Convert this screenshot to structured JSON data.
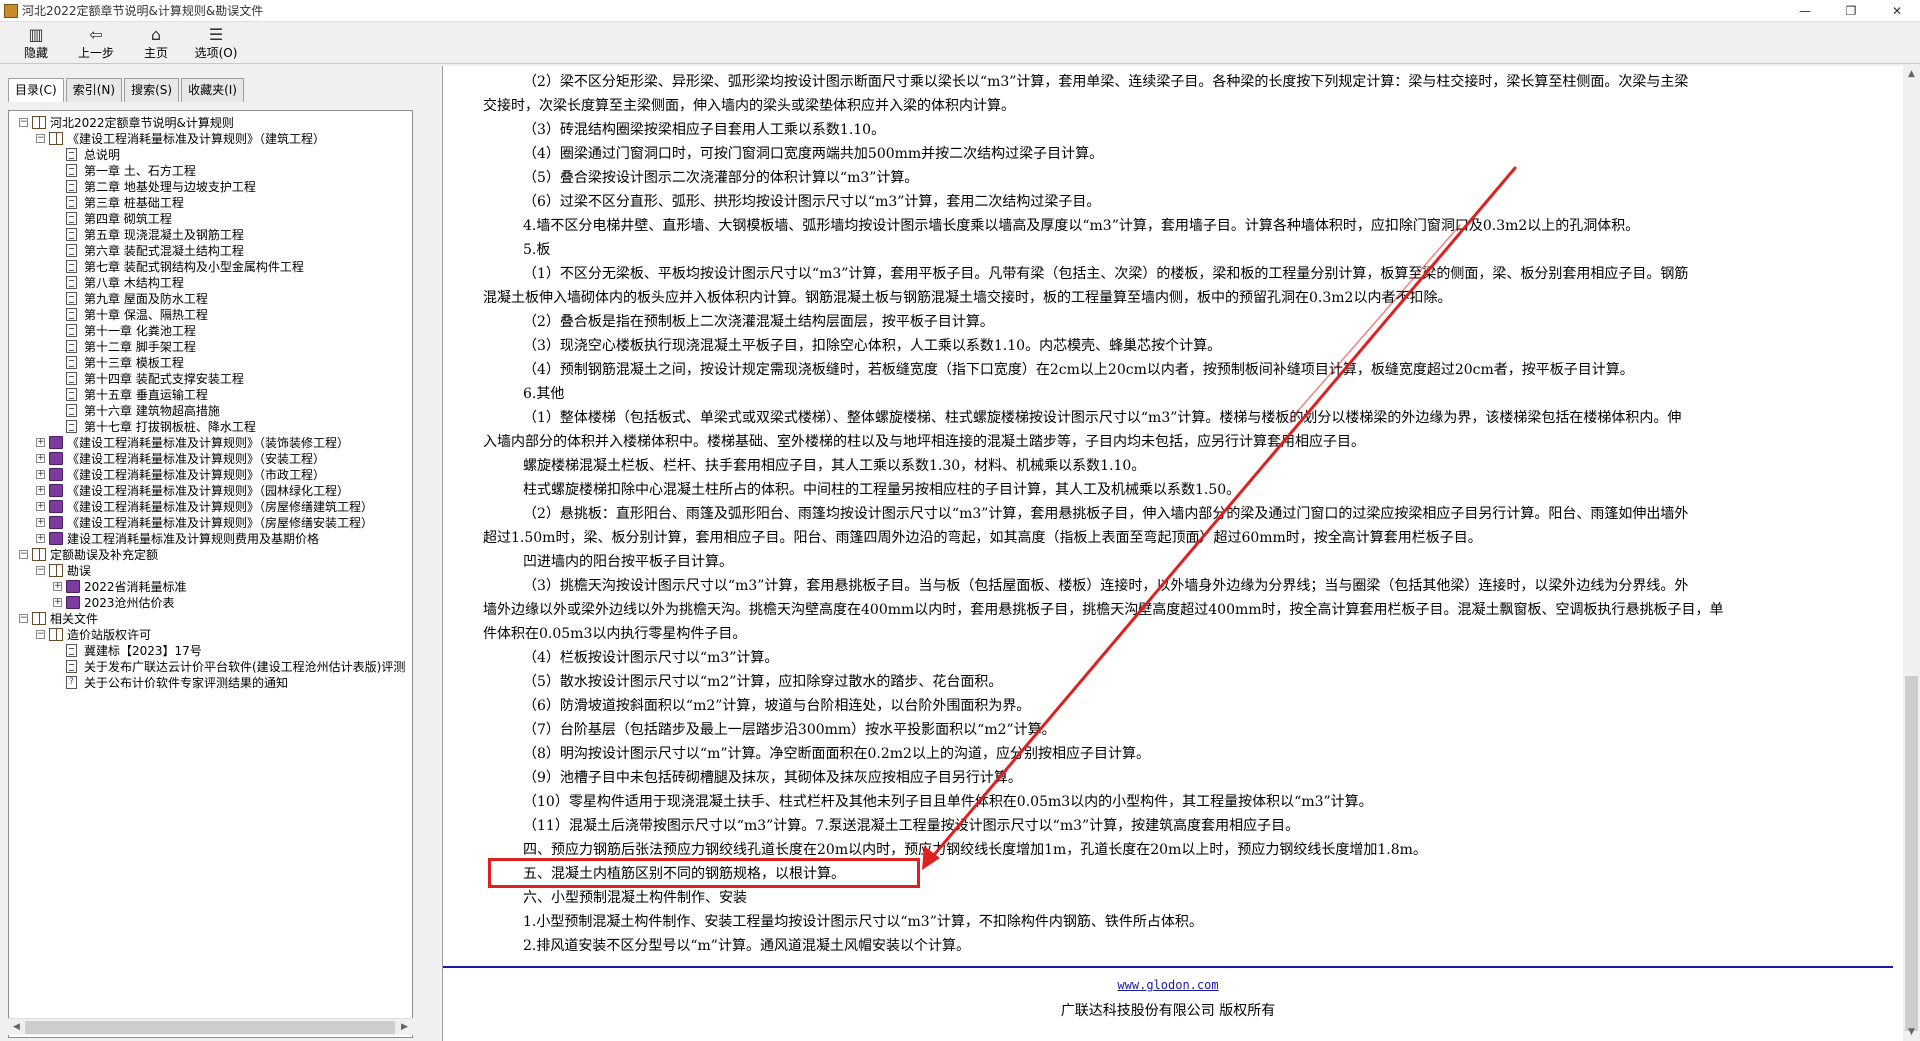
{
  "window": {
    "title": "河北2022定额章节说明&计算规则&勘误文件",
    "buttons": [
      "—",
      "❐",
      "✕"
    ]
  },
  "toolbar": [
    {
      "label": "隐藏",
      "icon": "hide-icon",
      "glyph": "▥"
    },
    {
      "label": "上一步",
      "icon": "back-arrow-icon",
      "glyph": "⇦"
    },
    {
      "label": "主页",
      "icon": "home-icon",
      "glyph": "⌂"
    },
    {
      "label": "选项(O)",
      "icon": "options-icon",
      "glyph": "☰"
    }
  ],
  "tabs": [
    "目录(C)",
    "索引(N)",
    "搜索(S)",
    "收藏夹(I)"
  ],
  "tree": [
    {
      "level": 0,
      "exp": "−",
      "icon": "openbook",
      "label": "河北2022定额章节说明&计算规则"
    },
    {
      "level": 1,
      "exp": "−",
      "icon": "openbook",
      "label": "《建设工程消耗量标准及计算规则》（建筑工程）"
    },
    {
      "level": 2,
      "exp": "",
      "icon": "page",
      "label": "总说明"
    },
    {
      "level": 2,
      "exp": "",
      "icon": "page",
      "label": "第一章 土、石方工程"
    },
    {
      "level": 2,
      "exp": "",
      "icon": "page",
      "label": "第二章 地基处理与边坡支护工程"
    },
    {
      "level": 2,
      "exp": "",
      "icon": "page",
      "label": "第三章 桩基础工程"
    },
    {
      "level": 2,
      "exp": "",
      "icon": "page",
      "label": "第四章 砌筑工程"
    },
    {
      "level": 2,
      "exp": "",
      "icon": "page",
      "label": "第五章 现浇混凝土及钢筋工程"
    },
    {
      "level": 2,
      "exp": "",
      "icon": "page",
      "label": "第六章 装配式混凝土结构工程"
    },
    {
      "level": 2,
      "exp": "",
      "icon": "page",
      "label": "第七章 装配式钢结构及小型金属构件工程"
    },
    {
      "level": 2,
      "exp": "",
      "icon": "page",
      "label": "第八章 木结构工程"
    },
    {
      "level": 2,
      "exp": "",
      "icon": "page",
      "label": "第九章 屋面及防水工程"
    },
    {
      "level": 2,
      "exp": "",
      "icon": "page",
      "label": "第十章 保温、隔热工程"
    },
    {
      "level": 2,
      "exp": "",
      "icon": "page",
      "label": "第十一章 化粪池工程"
    },
    {
      "level": 2,
      "exp": "",
      "icon": "page",
      "label": "第十二章 脚手架工程"
    },
    {
      "level": 2,
      "exp": "",
      "icon": "page",
      "label": "第十三章 模板工程"
    },
    {
      "level": 2,
      "exp": "",
      "icon": "page",
      "label": "第十四章 装配式支撑安装工程"
    },
    {
      "level": 2,
      "exp": "",
      "icon": "page",
      "label": "第十五章 垂直运输工程"
    },
    {
      "level": 2,
      "exp": "",
      "icon": "page",
      "label": "第十六章 建筑物超高措施"
    },
    {
      "level": 2,
      "exp": "",
      "icon": "page",
      "label": "第十七章 打拔钢板桩、降水工程"
    },
    {
      "level": 1,
      "exp": "+",
      "icon": "book",
      "label": "《建设工程消耗量标准及计算规则》（装饰装修工程）"
    },
    {
      "level": 1,
      "exp": "+",
      "icon": "book",
      "label": "《建设工程消耗量标准及计算规则》（安装工程）"
    },
    {
      "level": 1,
      "exp": "+",
      "icon": "book",
      "label": "《建设工程消耗量标准及计算规则》（市政工程）"
    },
    {
      "level": 1,
      "exp": "+",
      "icon": "book",
      "label": "《建设工程消耗量标准及计算规则》（园林绿化工程）"
    },
    {
      "level": 1,
      "exp": "+",
      "icon": "book",
      "label": "《建设工程消耗量标准及计算规则》（房屋修缮建筑工程）"
    },
    {
      "level": 1,
      "exp": "+",
      "icon": "book",
      "label": "《建设工程消耗量标准及计算规则》（房屋修缮安装工程）"
    },
    {
      "level": 1,
      "exp": "+",
      "icon": "book",
      "label": "建设工程消耗量标准及计算规则费用及基期价格"
    },
    {
      "level": 0,
      "exp": "−",
      "icon": "openbook",
      "label": "定额勘误及补充定额"
    },
    {
      "level": 1,
      "exp": "−",
      "icon": "openbook",
      "label": "勘误"
    },
    {
      "level": 2,
      "exp": "+",
      "icon": "book",
      "label": "2022省消耗量标准"
    },
    {
      "level": 2,
      "exp": "+",
      "icon": "book",
      "label": "2023沧州估价表"
    },
    {
      "level": 0,
      "exp": "−",
      "icon": "openbook",
      "label": "相关文件"
    },
    {
      "level": 1,
      "exp": "−",
      "icon": "openbook",
      "label": "造价站版权许可"
    },
    {
      "level": 2,
      "exp": "",
      "icon": "page",
      "label": "冀建标【2023】17号"
    },
    {
      "level": 2,
      "exp": "",
      "icon": "page",
      "label": "关于发布广联达云计价平台软件(建设工程沧州估计表版)评测"
    },
    {
      "level": 2,
      "exp": "",
      "icon": "help",
      "label": "关于公布计价软件专家评测结果的通知"
    }
  ],
  "content_lines": [
    "（2）梁不区分矩形梁、异形梁、弧形梁均按设计图示断面尺寸乘以梁长以“m3”计算，套用单梁、连续梁子目。各种梁的长度按下列规定计算：梁与柱交接时，梁长算至柱侧面。次梁与主梁",
    "交接时，次梁长度算至主梁侧面，伸入墙内的梁头或梁垫体积应并入梁的体积内计算。",
    "（3）砖混结构圈梁按梁相应子目套用人工乘以系数1.10。",
    "（4）圈梁通过门窗洞口时，可按门窗洞口宽度两端共加500mm并按二次结构过梁子目计算。",
    "（5）叠合梁按设计图示二次浇灌部分的体积计算以“m3”计算。",
    "（6）过梁不区分直形、弧形、拱形均按设计图示尺寸以“m3”计算，套用二次结构过梁子目。",
    "4.墙不区分电梯井壁、直形墙、大钢模板墙、弧形墙均按设计图示墙长度乘以墙高及厚度以“m3”计算，套用墙子目。计算各种墙体积时，应扣除门窗洞口及0.3m2以上的孔洞体积。",
    "5.板",
    "（1）不区分无梁板、平板均按设计图示尺寸以“m3”计算，套用平板子目。凡带有梁（包括主、次梁）的楼板，梁和板的工程量分别计算，板算至梁的侧面，梁、板分别套用相应子目。钢筋",
    "混凝土板伸入墙砌体内的板头应并入板体积内计算。钢筋混凝土板与钢筋混凝土墙交接时，板的工程量算至墙内侧，板中的预留孔洞在0.3m2以内者不扣除。",
    "（2）叠合板是指在预制板上二次浇灌混凝土结构层面层，按平板子目计算。",
    "（3）现浇空心楼板执行现浇混凝土平板子目，扣除空心体积，人工乘以系数1.10。内芯模壳、蜂巢芯按个计算。",
    "（4）预制钢筋混凝土之间，按设计规定需现浇板缝时，若板缝宽度（指下口宽度）在2cm以上20cm以内者，按预制板间补缝项目计算，板缝宽度超过20cm者，按平板子目计算。",
    "6.其他",
    "（1）整体楼梯（包括板式、单梁式或双梁式楼梯）、整体螺旋楼梯、柱式螺旋楼梯按设计图示尺寸以“m3”计算。楼梯与楼板的划分以楼梯梁的外边缘为界，该楼梯梁包括在楼梯体积内。伸",
    "入墙内部分的体积并入楼梯体积中。楼梯基础、室外楼梯的柱以及与地坪相连接的混凝土踏步等，子目内均未包括，应另行计算套用相应子目。",
    "螺旋楼梯混凝土栏板、栏杆、扶手套用相应子目，其人工乘以系数1.30，材料、机械乘以系数1.10。",
    "柱式螺旋楼梯扣除中心混凝土柱所占的体积。中间柱的工程量另按相应柱的子目计算，其人工及机械乘以系数1.50。",
    "（2）悬挑板：直形阳台、雨篷及弧形阳台、雨篷均按设计图示尺寸以“m3”计算，套用悬挑板子目，伸入墙内部分的梁及通过门窗口的过梁应按梁相应子目另行计算。阳台、雨篷如伸出墙外",
    "超过1.50m时，梁、板分别计算，套用相应子目。阳台、雨篷四周外边沿的弯起，如其高度（指板上表面至弯起顶面）超过60mm时，按全高计算套用栏板子目。",
    "凹进墙内的阳台按平板子目计算。",
    "（3）挑檐天沟按设计图示尺寸以“m3”计算，套用悬挑板子目。当与板（包括屋面板、楼板）连接时，以外墙身外边缘为分界线；当与圈梁（包括其他梁）连接时，以梁外边线为分界线。外",
    "墙外边缘以外或梁外边线以外为挑檐天沟。挑檐天沟壁高度在400mm以内时，套用悬挑板子目，挑檐天沟壁高度超过400mm时，按全高计算套用栏板子目。混凝土飘窗板、空调板执行悬挑板子目，单",
    "件体积在0.05m3以内执行零星构件子目。",
    "（4）栏板按设计图示尺寸以“m3”计算。",
    "（5）散水按设计图示尺寸以“m2”计算，应扣除穿过散水的踏步、花台面积。",
    "（6）防滑坡道按斜面积以“m2”计算，坡道与台阶相连处，以台阶外围面积为界。",
    "（7）台阶基层（包括踏步及最上一层踏步沿300mm）按水平投影面积以“m2”计算。",
    "（8）明沟按设计图示尺寸以“m”计算。净空断面面积在0.2m2以上的沟道，应分别按相应子目计算。",
    "（9）池槽子目中未包括砖砌槽腿及抹灰，其砌体及抹灰应按相应子目另行计算。",
    "（10）零星构件适用于现浇混凝土扶手、柱式栏杆及其他未列子目且单件体积在0.05m3以内的小型构件，其工程量按体积以“m3”计算。",
    "（11）混凝土后浇带按图示尺寸以“m3”计算。7.泵送混凝土工程量按设计图示尺寸以“m3”计算，按建筑高度套用相应子目。",
    "四、预应力钢筋后张法预应力钢绞线孔道长度在20m以内时，预应力钢绞线长度增加1m，孔道长度在20m以上时，预应力钢绞线长度增加1.8m。",
    "五、混凝土内植筋区别不同的钢筋规格，以根计算。",
    "六、小型预制混凝土构件制作、安装",
    "1.小型预制混凝土构件制作、安装工程量均按设计图示尺寸以“m3”计算，不扣除构件内钢筋、铁件所占体积。",
    "2.排风道安装不区分型号以“m”计算。通风道混凝土风帽安装以个计算。"
  ],
  "footer": {
    "link": "www.glodon.com",
    "copyright": "广联达科技股份有限公司 版权所有"
  },
  "annotation_color": "#e02020"
}
